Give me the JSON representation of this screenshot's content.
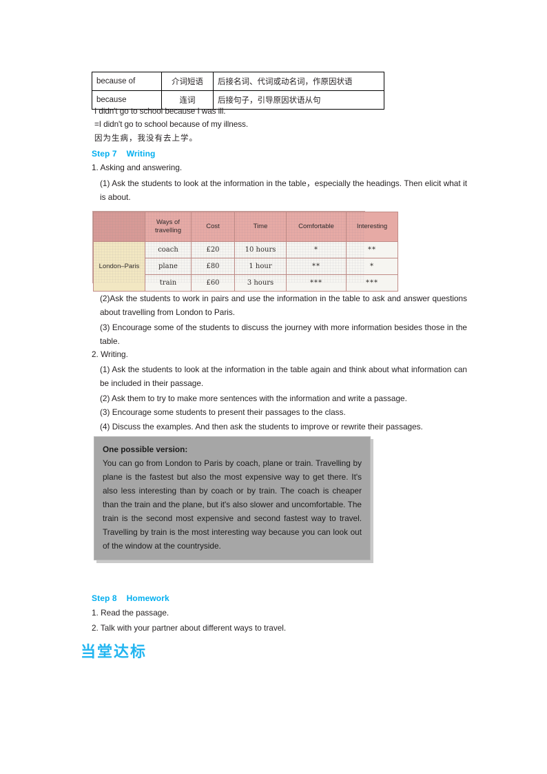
{
  "grammar_table": {
    "rows": [
      {
        "term": "because of",
        "part_of_speech": "介词短语",
        "definition": "后接名词、代词或动名词，作原因状语"
      },
      {
        "term": "because",
        "part_of_speech": "连词",
        "definition": "后接句子，引导原因状语从句"
      }
    ]
  },
  "examples": {
    "line1": "I didn't go to school because I was ill.",
    "line2": "=I didn't go to school because of my illness.",
    "line3": "因为生病，我没有去上学。"
  },
  "step7": {
    "label": "Step 7",
    "title": "Writing",
    "item1_heading": "1. Asking and answering.",
    "item1_1": "(1) Ask the students to look at the information in the table，especially the headings. Then elicit what it is about.",
    "item1_2": "(2)Ask the students to work in pairs and use the information in the table to ask and answer questions about travelling from London to Paris.",
    "item1_3": "(3) Encourage some of the students to discuss the journey with more information besides those in the table.",
    "item2_heading": "2. Writing.",
    "item2_1": "(1) Ask the students to look at the information in the table again and think about what information can be included in their passage.",
    "item2_2": "(2) Ask them to try to make more sentences with the information and write a passage.",
    "item2_3": "(3) Encourage some students to present their passages to the class.",
    "item2_4": "(4) Discuss the examples. And then ask the students to improve or rewrite their passages."
  },
  "travel_table": {
    "corner": "",
    "headers": [
      "Ways of travelling",
      "Cost",
      "Time",
      "Comfortable",
      "Interesting"
    ],
    "header_way_line1": "Ways of",
    "header_way_line2": "travelling",
    "row_label": "London–Paris",
    "rows": [
      {
        "way": "coach",
        "cost": "£20",
        "time": "10 hours",
        "comfortable": "*",
        "interesting": "**"
      },
      {
        "way": "plane",
        "cost": "£80",
        "time": "1 hour",
        "comfortable": "**",
        "interesting": "*"
      },
      {
        "way": "train",
        "cost": "£60",
        "time": "3 hours",
        "comfortable": "***",
        "interesting": "***"
      }
    ]
  },
  "answer_box": {
    "title": "One possible version:",
    "body": "You can go from London to Paris by coach, plane or train. Travelling by plane is the fastest but also the most expensive way to get there. It's also less interesting than by coach or by train. The coach is cheaper than the train and the plane, but it's also slower and uncomfortable. The train is the second most expensive and second fastest way to travel. Travelling by train is the most interesting way because you can look out of the window at the countryside."
  },
  "step8": {
    "label": "Step 8",
    "title": "Homework",
    "item1": "1. Read the passage.",
    "item2": "2. Talk with your partner about different ways to travel."
  },
  "section_heading_cn": "当堂达标",
  "colors": {
    "accent_cyan": "#00AEEF",
    "heading_cyan": "#22B5F0",
    "table_header_rose": "#e6aaa5",
    "table_corner_rose": "#d79a96",
    "table_rowlabel_cream": "#f2e7c2",
    "answer_box_gray": "#a6a6a6",
    "text": "#231f20"
  }
}
